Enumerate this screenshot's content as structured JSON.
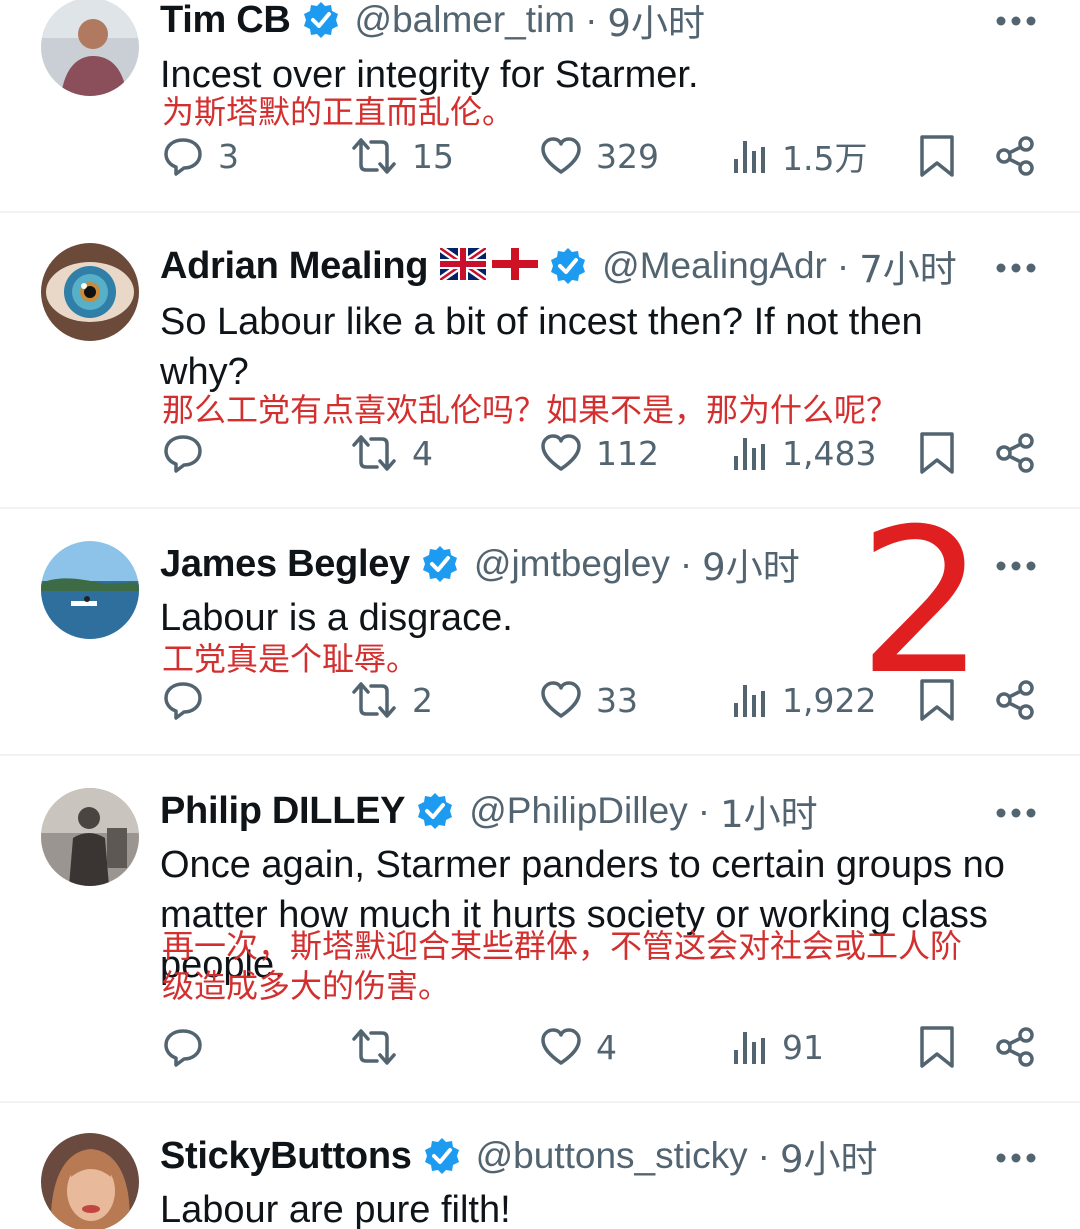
{
  "tweets": [
    {
      "name": "Tim CB",
      "handle": "@balmer_tim",
      "separator": "·",
      "time": "9小时",
      "text": "Incest over integrity for Starmer.",
      "translation": "为斯塔默的正直而乱伦。",
      "replies": "3",
      "retweets": "15",
      "likes": "329",
      "views": "1.5万"
    },
    {
      "name": "Adrian Mealing",
      "handle": "@MealingAdr",
      "separator": "·",
      "time": "7小时",
      "text": "So Labour like a bit of incest then? If not then why?",
      "translation": "那么工党有点喜欢乱伦吗？如果不是，那为什么呢？",
      "replies": "",
      "retweets": "4",
      "likes": "112",
      "views": "1,483"
    },
    {
      "name": "James Begley",
      "handle": "@jmtbegley",
      "separator": "·",
      "time": "9小时",
      "text": "Labour is  a disgrace.",
      "translation": "工党真是个耻辱。",
      "replies": "",
      "retweets": "2",
      "likes": "33",
      "views": "1,922"
    },
    {
      "name": "Philip DILLEY",
      "handle": "@PhilipDilley",
      "separator": "·",
      "time": "1小时",
      "text": "Once again, Starmer panders to certain groups no matter how much it hurts society or working class people.",
      "translation": "再一次，斯塔默迎合某些群体，不管这会对社会或工人阶级造成多大的伤害。",
      "replies": "",
      "retweets": "",
      "likes": "4",
      "views": "91"
    },
    {
      "name": "StickyButtons",
      "handle": "@buttons_sticky",
      "separator": "·",
      "time": "9小时",
      "text": "Labour are pure filth!",
      "translation": "",
      "replies": "",
      "retweets": "",
      "likes": "",
      "views": ""
    }
  ],
  "annotation_mark": "2",
  "colors": {
    "text": "#0f1419",
    "secondary": "#536471",
    "verified": "#1d9bf0",
    "translation_red": "#d32f2f",
    "divider": "#eff3f4"
  },
  "icons": [
    "verified-badge-icon",
    "uk-flag-icon",
    "england-flag-icon",
    "more-icon",
    "reply-icon",
    "retweet-icon",
    "like-icon",
    "views-icon",
    "bookmark-icon",
    "share-icon"
  ]
}
